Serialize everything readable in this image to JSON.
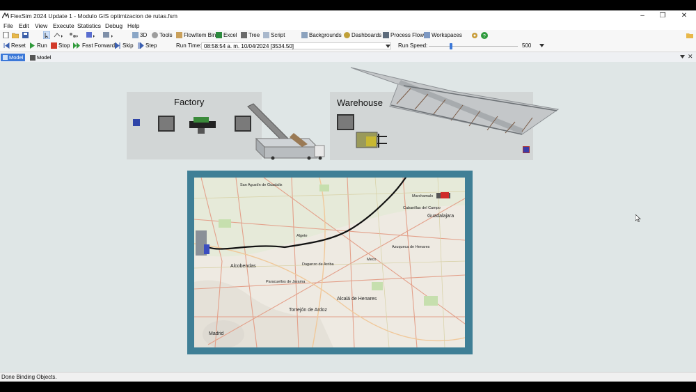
{
  "window": {
    "title": "FlexSim 2024 Update 1 - Modulo GIS optimizacion de rutas.fsm"
  },
  "menu": [
    "File",
    "Edit",
    "View",
    "Execute",
    "Statistics",
    "Debug",
    "Help"
  ],
  "toolbar": {
    "view_3d": "3D",
    "tools": "Tools",
    "flowitem_bin": "FlowItem Bin",
    "excel": "Excel",
    "tree": "Tree",
    "script": "Script",
    "backgrounds": "Backgrounds",
    "dashboards": "Dashboards",
    "process_flow": "Process Flow",
    "workspaces": "Workspaces"
  },
  "run_controls": {
    "reset": "Reset",
    "run": "Run",
    "stop": "Stop",
    "fast_forward": "Fast Forward",
    "skip": "Skip",
    "step": "Step",
    "run_time_label": "Run Time:",
    "run_time_value": "08:58:54 a. m.  10/04/2024  [3534.50]",
    "run_speed_label": "Run Speed:",
    "run_speed_value": "500",
    "run_speed_level_fraction": 0.25
  },
  "tabs": [
    "Model",
    "Model"
  ],
  "model": {
    "factory_label": "Factory",
    "warehouse_label": "Warehouse"
  },
  "map": {
    "cities": [
      "San Agustín de Guadalix",
      "Marchamalo",
      "Guadalajara",
      "Cabanillas del Campo",
      "Alcobendas",
      "Algete",
      "Azuqueca de Henares",
      "Meco",
      "Daganzo de Arriba",
      "Paracuellos de Jarama",
      "Alcalá de Henares",
      "Torrejón de Ardoz",
      "Madrid"
    ]
  },
  "status": {
    "text": "Done Binding Objects."
  },
  "colors": {
    "accent": "#3b78d8",
    "map_frame": "#3f7f96",
    "route": "#111111"
  }
}
